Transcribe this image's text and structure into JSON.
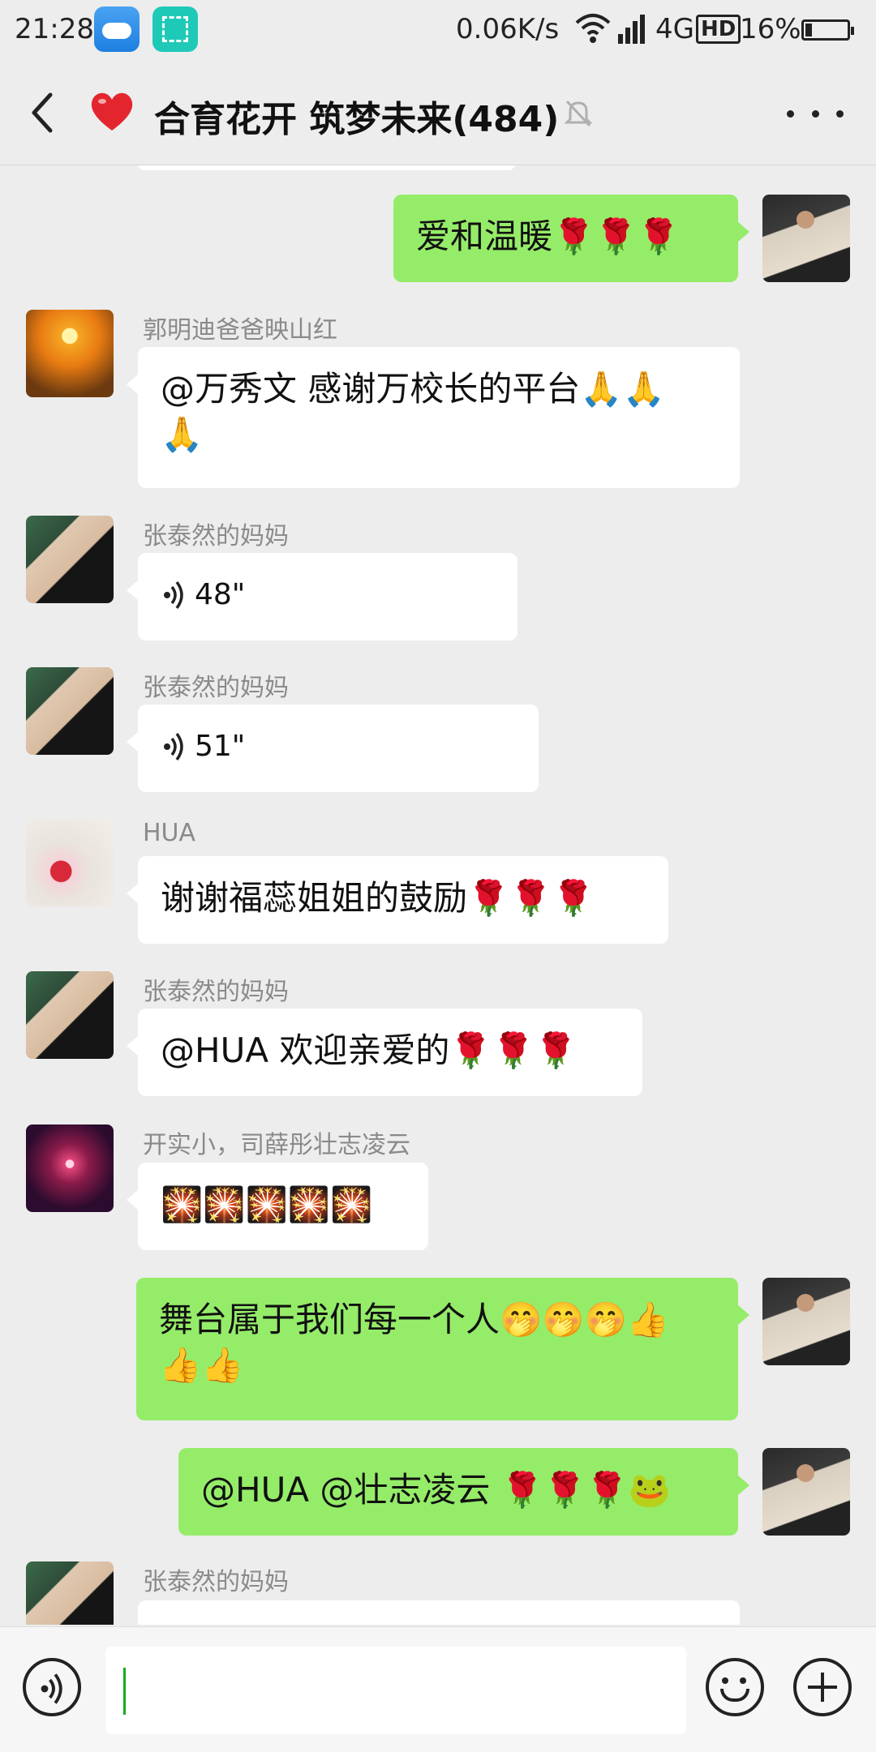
{
  "status_bar": {
    "time": "21:28",
    "net_speed": "0.06K/s",
    "network": "4G",
    "hd": "HD",
    "battery": "16%"
  },
  "title_bar": {
    "title": "合育花开 筑梦未来(484)",
    "icons": [
      "back-icon",
      "heart-icon",
      "mute-icon",
      "more-icon"
    ]
  },
  "messages": [
    {
      "side": "out",
      "text": "爱和温暖🌹🌹🌹"
    },
    {
      "side": "in",
      "sender": "郭明迪爸爸映山红",
      "line1": "@万秀文  感谢万校长的平台🙏🙏",
      "line2": "🙏"
    },
    {
      "side": "in",
      "sender": "张泰然的妈妈",
      "voice": "48\""
    },
    {
      "side": "in",
      "sender": "张泰然的妈妈",
      "voice": "51\""
    },
    {
      "side": "in",
      "sender": "HUA",
      "text": "谢谢福蕊姐姐的鼓励🌹🌹🌹"
    },
    {
      "side": "in",
      "sender": "张泰然的妈妈",
      "text": "@HUA  欢迎亲爱的🌹🌹🌹"
    },
    {
      "side": "in",
      "sender": "开实小，司薛彤壮志凌云",
      "text": "🎇🎇🎇🎇🎇"
    },
    {
      "side": "out",
      "line1": "舞台属于我们每一个人🤭🤭🤭👍",
      "line2": "👍👍"
    },
    {
      "side": "out",
      "text": "@HUA @壮志凌云 🌹🌹🌹🐸"
    },
    {
      "side": "in",
      "sender": "张泰然的妈妈"
    }
  ],
  "input_bar": {
    "value": "",
    "icons": [
      "voice-icon",
      "emoji-icon",
      "plus-icon"
    ]
  },
  "colors": {
    "background": "#ededed",
    "outgoing_bubble": "#95ec69",
    "incoming_bubble": "#ffffff",
    "caret": "#1aad19"
  }
}
